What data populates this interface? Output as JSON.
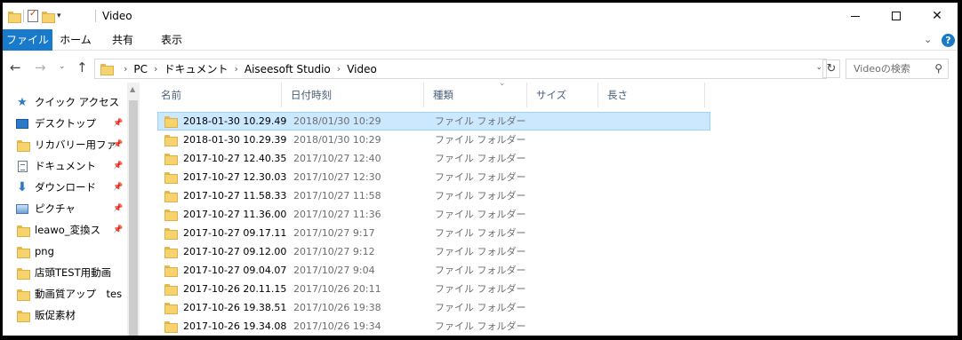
{
  "window": {
    "title": "Video"
  },
  "ribbon": {
    "tabs": [
      "ファイル",
      "ホーム",
      "共有",
      "表示"
    ],
    "expand_icon": "chevron-down",
    "help_label": "?"
  },
  "address": {
    "crumbs": [
      "PC",
      "ドキュメント",
      "Aiseesoft Studio",
      "Video"
    ]
  },
  "search": {
    "placeholder": "Videoの検索"
  },
  "nav_pane": {
    "items": [
      {
        "label": "クイック アクセス",
        "icon": "star-icon",
        "pinned": false
      },
      {
        "label": "デスクトップ",
        "icon": "desktop-icon",
        "pinned": true
      },
      {
        "label": "リカバリー用ファ",
        "icon": "folder-icon",
        "pinned": true
      },
      {
        "label": "ドキュメント",
        "icon": "documents-icon",
        "pinned": true
      },
      {
        "label": "ダウンロード",
        "icon": "download-icon",
        "pinned": true
      },
      {
        "label": "ピクチャ",
        "icon": "pictures-icon",
        "pinned": true
      },
      {
        "label": "leawo_変換ス",
        "icon": "folder-icon",
        "pinned": true
      },
      {
        "label": "png",
        "icon": "folder-icon",
        "pinned": false
      },
      {
        "label": "店頭TEST用動画",
        "icon": "folder-icon",
        "pinned": false
      },
      {
        "label": "動画質アップ　tes",
        "icon": "folder-icon",
        "pinned": false
      },
      {
        "label": "販促素材",
        "icon": "folder-icon",
        "pinned": false
      }
    ]
  },
  "columns": [
    "名前",
    "日付時刻",
    "種類",
    "サイズ",
    "長さ"
  ],
  "files": [
    {
      "name": "2018-01-30 10.29.49",
      "date": "2018/01/30 10:29",
      "type": "ファイル フォルダー",
      "selected": true
    },
    {
      "name": "2018-01-30 10.29.39",
      "date": "2018/01/30 10:29",
      "type": "ファイル フォルダー",
      "selected": false
    },
    {
      "name": "2017-10-27 12.40.35",
      "date": "2017/10/27 12:40",
      "type": "ファイル フォルダー",
      "selected": false
    },
    {
      "name": "2017-10-27 12.30.03",
      "date": "2017/10/27 12:30",
      "type": "ファイル フォルダー",
      "selected": false
    },
    {
      "name": "2017-10-27 11.58.33",
      "date": "2017/10/27 11:58",
      "type": "ファイル フォルダー",
      "selected": false
    },
    {
      "name": "2017-10-27 11.36.00",
      "date": "2017/10/27 11:36",
      "type": "ファイル フォルダー",
      "selected": false
    },
    {
      "name": "2017-10-27 09.17.11",
      "date": "2017/10/27 9:17",
      "type": "ファイル フォルダー",
      "selected": false
    },
    {
      "name": "2017-10-27 09.12.00",
      "date": "2017/10/27 9:12",
      "type": "ファイル フォルダー",
      "selected": false
    },
    {
      "name": "2017-10-27 09.04.07",
      "date": "2017/10/27 9:04",
      "type": "ファイル フォルダー",
      "selected": false
    },
    {
      "name": "2017-10-26 20.11.15",
      "date": "2017/10/26 20:11",
      "type": "ファイル フォルダー",
      "selected": false
    },
    {
      "name": "2017-10-26 19.38.51",
      "date": "2017/10/26 19:38",
      "type": "ファイル フォルダー",
      "selected": false
    },
    {
      "name": "2017-10-26 19.34.08",
      "date": "2017/10/26 19:34",
      "type": "ファイル フォルダー",
      "selected": false
    }
  ],
  "colors": {
    "accent": "#1979ca",
    "selection": "#cce8ff",
    "selection_border": "#99d1ff",
    "folder": "#f6d36d"
  }
}
